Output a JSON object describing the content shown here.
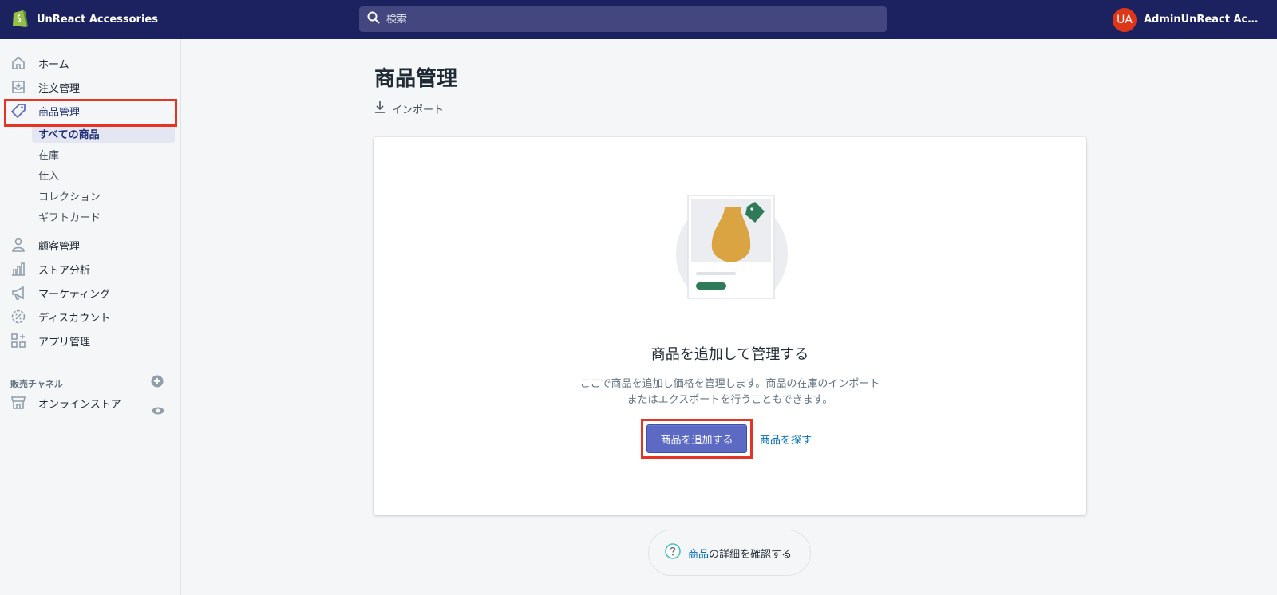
{
  "topbar": {
    "store_name": "UnReact Accessories",
    "search_placeholder": "検索",
    "user_initials": "UA",
    "user_name": "AdminUnReact Accessories"
  },
  "sidebar": {
    "items": [
      {
        "label": "ホーム",
        "icon": "home-icon"
      },
      {
        "label": "注文管理",
        "icon": "orders-icon"
      },
      {
        "label": "商品管理",
        "icon": "tag-icon"
      },
      {
        "label": "顧客管理",
        "icon": "customer-icon"
      },
      {
        "label": "ストア分析",
        "icon": "analytics-icon"
      },
      {
        "label": "マーケティング",
        "icon": "megaphone-icon"
      },
      {
        "label": "ディスカウント",
        "icon": "discount-icon"
      },
      {
        "label": "アプリ管理",
        "icon": "apps-icon"
      }
    ],
    "sub_items": [
      "すべての商品",
      "在庫",
      "仕入",
      "コレクション",
      "ギフトカード"
    ],
    "channels_heading": "販売チャネル",
    "channels": [
      {
        "label": "オンラインストア",
        "icon": "store-icon"
      }
    ]
  },
  "main": {
    "title": "商品管理",
    "import_label": "インポート",
    "empty_title": "商品を追加して管理する",
    "empty_desc": "ここで商品を追加し価格を管理します。商品の在庫のインポートまたはエクスポートを行うこともできます。",
    "primary_button": "商品を追加する",
    "secondary_link": "商品を探す",
    "help_link": "商品",
    "help_text": "の詳細を確認する"
  },
  "colors": {
    "topbar": "#1c2260",
    "accent": "#5c6ac4",
    "highlight": "#e53324",
    "link": "#006fbb"
  }
}
